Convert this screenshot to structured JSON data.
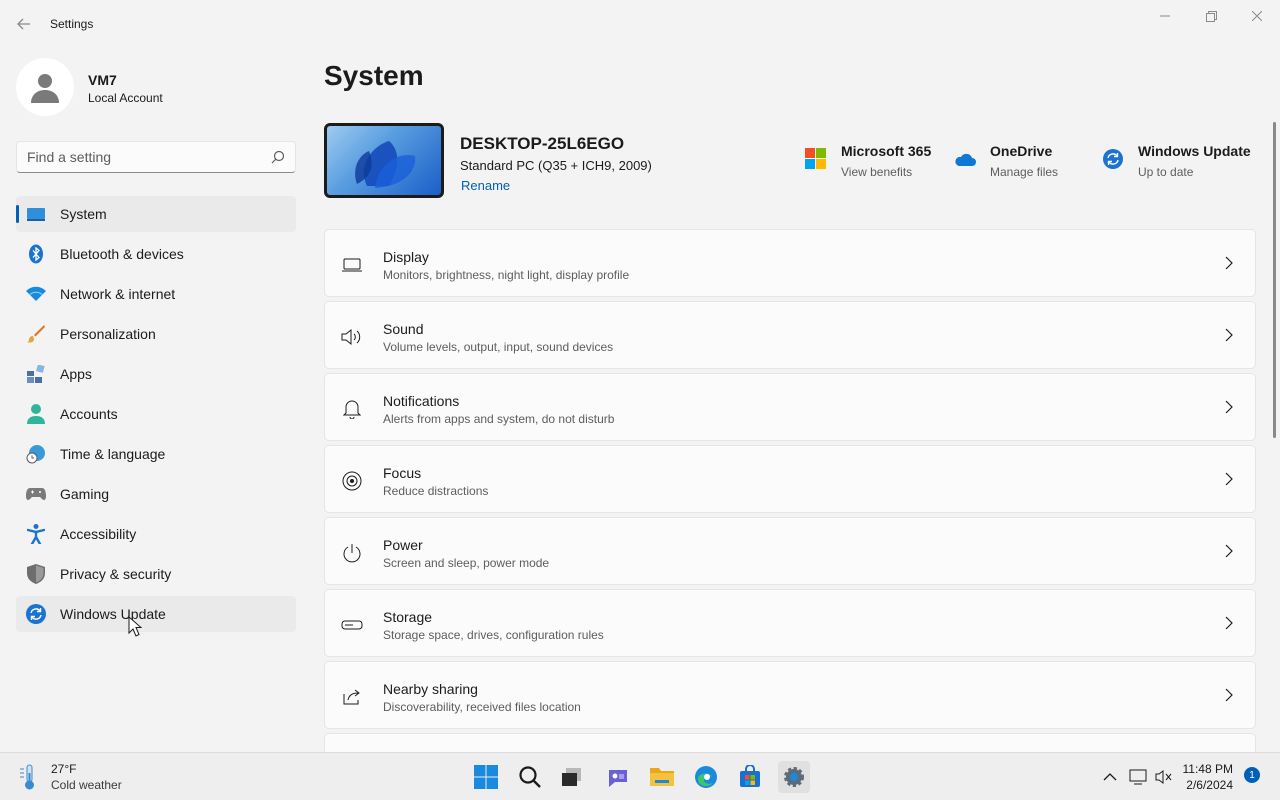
{
  "window": {
    "title": "Settings"
  },
  "profile": {
    "name": "VM7",
    "account_type": "Local Account"
  },
  "search": {
    "placeholder": "Find a setting"
  },
  "sidebar": {
    "items": [
      {
        "label": "System",
        "icon": "monitor-icon",
        "active": true
      },
      {
        "label": "Bluetooth & devices",
        "icon": "bluetooth-icon"
      },
      {
        "label": "Network & internet",
        "icon": "wifi-icon"
      },
      {
        "label": "Personalization",
        "icon": "paintbrush-icon"
      },
      {
        "label": "Apps",
        "icon": "apps-icon"
      },
      {
        "label": "Accounts",
        "icon": "person-icon"
      },
      {
        "label": "Time & language",
        "icon": "globe-clock-icon"
      },
      {
        "label": "Gaming",
        "icon": "gamepad-icon"
      },
      {
        "label": "Accessibility",
        "icon": "accessibility-icon"
      },
      {
        "label": "Privacy & security",
        "icon": "shield-icon"
      },
      {
        "label": "Windows Update",
        "icon": "sync-icon",
        "hover": true
      }
    ]
  },
  "main": {
    "title": "System",
    "device": {
      "name": "DESKTOP-25L6EGO",
      "model": "Standard PC (Q35 + ICH9, 2009)",
      "rename_label": "Rename"
    },
    "quick_links": [
      {
        "title": "Microsoft 365",
        "subtitle": "View benefits",
        "icon": "microsoft-logo-icon"
      },
      {
        "title": "OneDrive",
        "subtitle": "Manage files",
        "icon": "cloud-icon"
      },
      {
        "title": "Windows Update",
        "subtitle": "Up to date",
        "icon": "sync-icon"
      }
    ],
    "cards": [
      {
        "title": "Display",
        "subtitle": "Monitors, brightness, night light, display profile",
        "icon": "laptop-icon"
      },
      {
        "title": "Sound",
        "subtitle": "Volume levels, output, input, sound devices",
        "icon": "speaker-icon"
      },
      {
        "title": "Notifications",
        "subtitle": "Alerts from apps and system, do not disturb",
        "icon": "bell-icon"
      },
      {
        "title": "Focus",
        "subtitle": "Reduce distractions",
        "icon": "focus-icon"
      },
      {
        "title": "Power",
        "subtitle": "Screen and sleep, power mode",
        "icon": "power-icon"
      },
      {
        "title": "Storage",
        "subtitle": "Storage space, drives, configuration rules",
        "icon": "drive-icon"
      },
      {
        "title": "Nearby sharing",
        "subtitle": "Discoverability, received files location",
        "icon": "share-icon"
      }
    ]
  },
  "taskbar": {
    "weather": {
      "temp": "27°F",
      "desc": "Cold weather"
    },
    "apps": [
      "start-icon",
      "search-icon",
      "task-view-icon",
      "teams-chat-icon",
      "file-explorer-icon",
      "edge-icon",
      "store-icon",
      "settings-icon"
    ],
    "clock": {
      "time": "11:48 PM",
      "date": "2/6/2024"
    },
    "notification_count": "1"
  },
  "colors": {
    "accent": "#005fb8",
    "background": "#f3f3f3",
    "card": "#fbfbfb"
  }
}
